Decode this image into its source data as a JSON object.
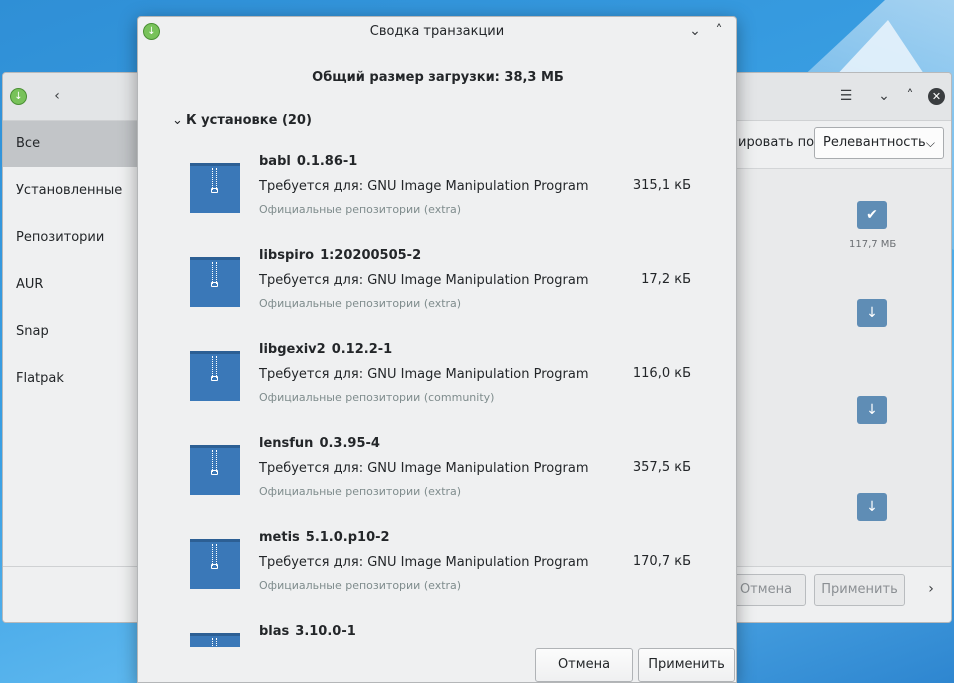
{
  "background_window": {
    "sidebar": [
      {
        "label": "Все",
        "active": true
      },
      {
        "label": "Установленные",
        "active": false
      },
      {
        "label": "Репозитории",
        "active": false
      },
      {
        "label": "AUR",
        "active": false
      },
      {
        "label": "Snap",
        "active": false
      },
      {
        "label": "Flatpak",
        "active": false
      }
    ],
    "sort_label": "ировать по",
    "sort_value": "Релевантность",
    "installed_size": "117,7 МБ",
    "cancel_label": "Отмена",
    "apply_label": "Применить"
  },
  "dialog": {
    "title": "Сводка транзакции",
    "heading": "Общий размер загрузки: 38,3 МБ",
    "group_label": "К установке (20)",
    "packages": [
      {
        "name": "babl",
        "version": "0.1.86-1",
        "required_by": "Требуется для: GNU Image Manipulation Program",
        "repo": "Официальные репозитории (extra)",
        "size": "315,1 кБ"
      },
      {
        "name": "libspiro",
        "version": "1:20200505-2",
        "required_by": "Требуется для: GNU Image Manipulation Program",
        "repo": "Официальные репозитории (extra)",
        "size": "17,2 кБ"
      },
      {
        "name": "libgexiv2",
        "version": "0.12.2-1",
        "required_by": "Требуется для: GNU Image Manipulation Program",
        "repo": "Официальные репозитории (community)",
        "size": "116,0 кБ"
      },
      {
        "name": "lensfun",
        "version": "0.3.95-4",
        "required_by": "Требуется для: GNU Image Manipulation Program",
        "repo": "Официальные репозитории (extra)",
        "size": "357,5 кБ"
      },
      {
        "name": "metis",
        "version": "5.1.0.p10-2",
        "required_by": "Требуется для: GNU Image Manipulation Program",
        "repo": "Официальные репозитории (extra)",
        "size": "170,7 кБ"
      },
      {
        "name": "blas",
        "version": "3.10.0-1",
        "required_by": "",
        "repo": "",
        "size": ""
      }
    ],
    "cancel_label": "Отмена",
    "apply_label": "Применить"
  },
  "colors": {
    "accent_blue": "#3a78b8",
    "action_button": "#5f8db5",
    "download_green": "#78c25a"
  }
}
